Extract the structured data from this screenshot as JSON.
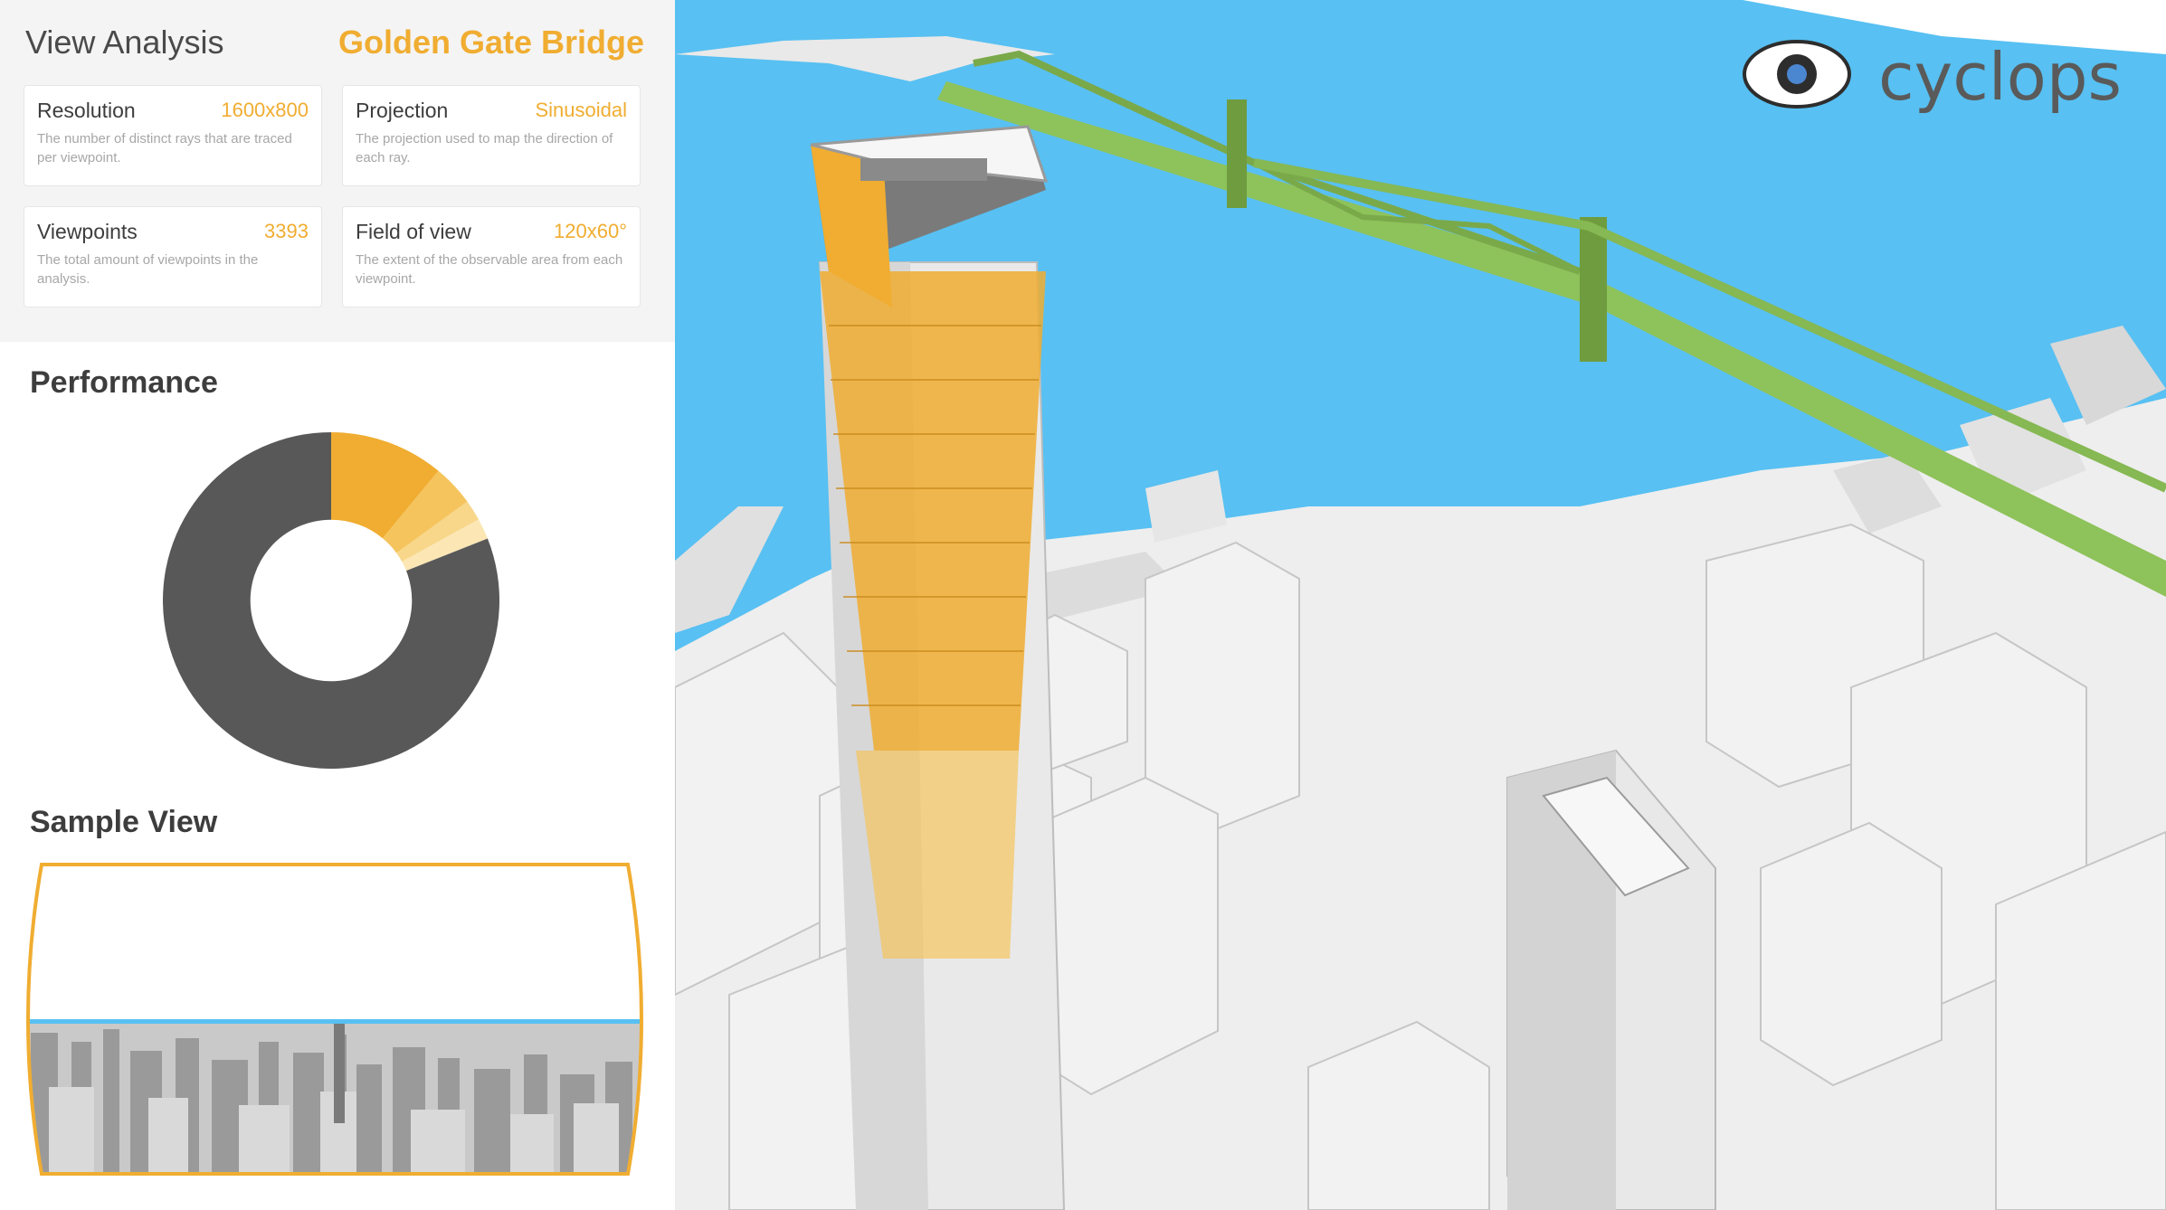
{
  "header": {
    "title": "View Analysis",
    "target": "Golden Gate Bridge"
  },
  "cards": [
    {
      "label": "Resolution",
      "value": "1600x800",
      "description": "The number of distinct rays that are traced per viewpoint."
    },
    {
      "label": "Projection",
      "value": "Sinusoidal",
      "description": "The projection used to map the direction of each ray."
    },
    {
      "label": "Viewpoints",
      "value": "3393",
      "description": "The total amount of viewpoints in the analysis."
    },
    {
      "label": "Field of view",
      "value": "120x60°",
      "description": "The extent of the observable area from each viewpoint."
    }
  ],
  "performance": {
    "title": "Performance"
  },
  "chart_data": {
    "type": "pie",
    "hole": 0.48,
    "series": [
      {
        "values": [
          0.11,
          0.04,
          0.02,
          0.02,
          0.81
        ]
      }
    ],
    "colors": [
      "#f0ad31",
      "#f5c45d",
      "#f8d78a",
      "#fbe6b4",
      "#585858"
    ]
  },
  "sample_view": {
    "title": "Sample View"
  },
  "logo": {
    "text": "cyclops"
  },
  "colors": {
    "accent": "#f0ad31",
    "water": "#58c0f2",
    "bridge": "#8ec25a",
    "dark_gray": "#585858"
  }
}
